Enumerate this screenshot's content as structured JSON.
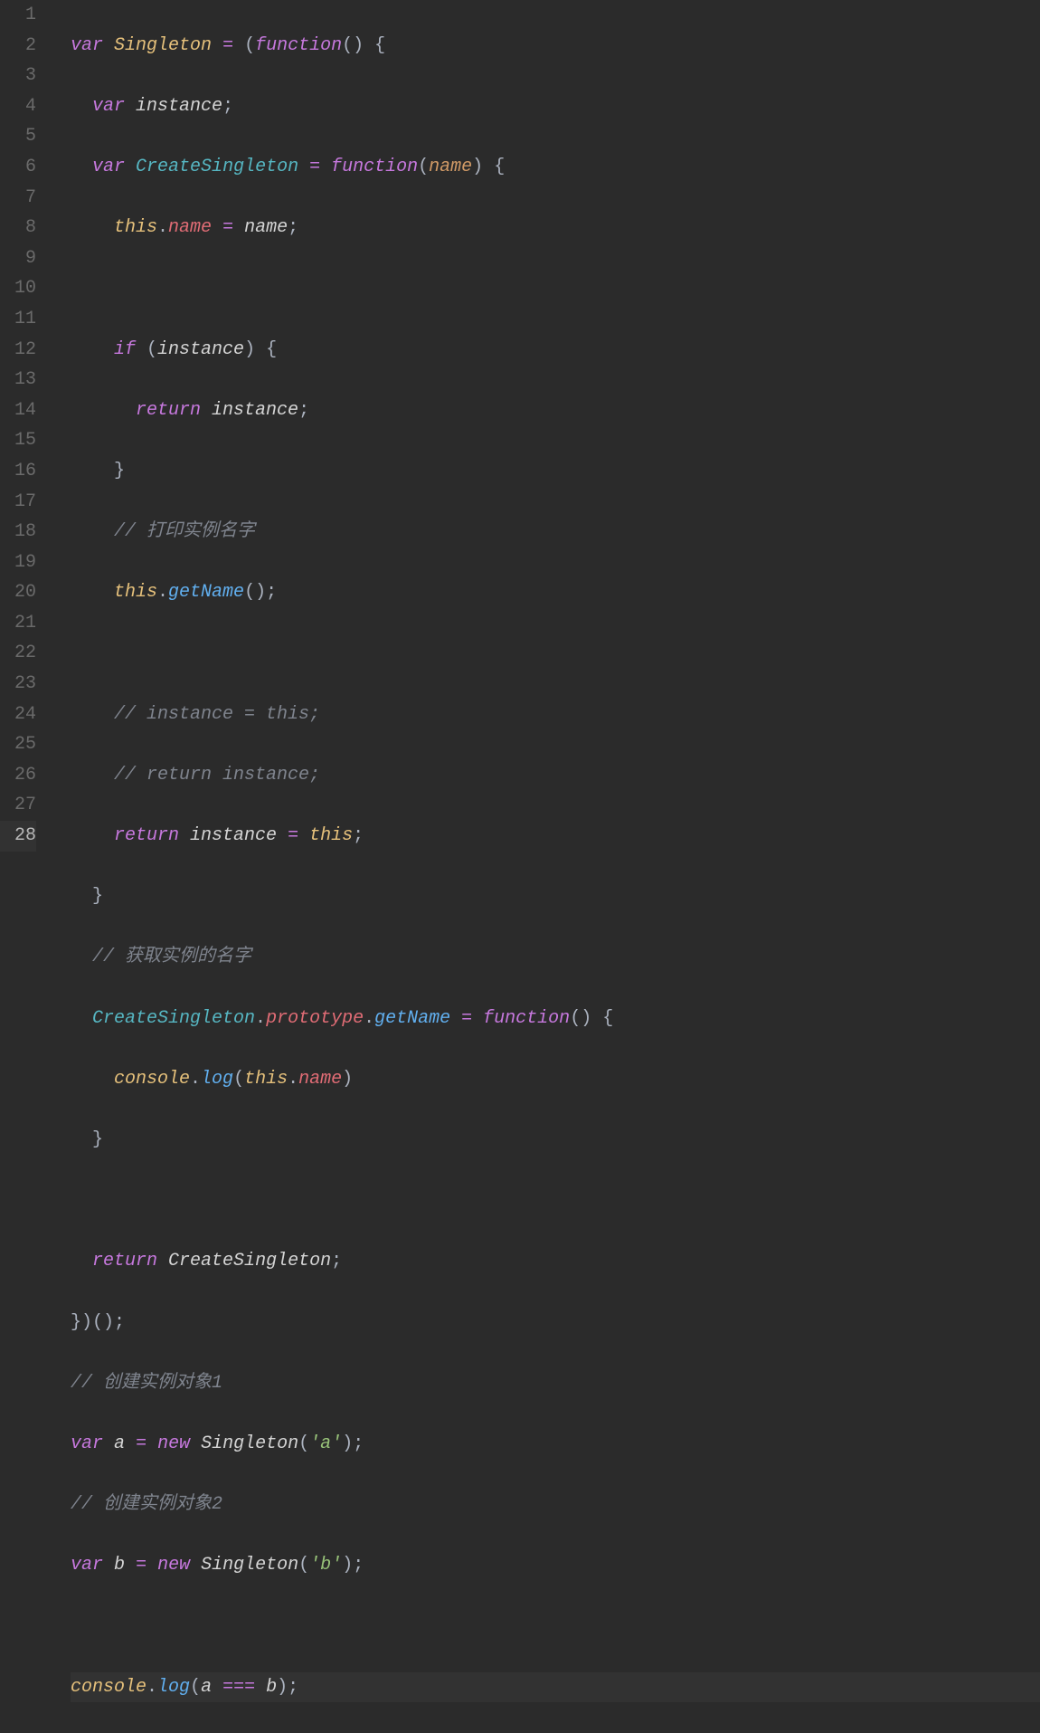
{
  "editor": {
    "activeLine": 28,
    "lineNumbers": [
      "1",
      "2",
      "3",
      "4",
      "5",
      "6",
      "7",
      "8",
      "9",
      "10",
      "11",
      "12",
      "13",
      "14",
      "15",
      "16",
      "17",
      "18",
      "19",
      "20",
      "21",
      "22",
      "23",
      "24",
      "25",
      "26",
      "27",
      "28"
    ],
    "tokens": {
      "l1": {
        "var": "var",
        "Singleton": "Singleton",
        "eq": "=",
        "paren": "(",
        "function": "function",
        "p2": "()",
        "brace": " {"
      },
      "l2": {
        "var": "var",
        "instance": "instance",
        "semi": ";"
      },
      "l3": {
        "var": "var",
        "CreateSingleton": "CreateSingleton",
        "eq": "=",
        "function": "function",
        "p": "(",
        "name": "name",
        "p2": ")",
        "brace": " {"
      },
      "l4": {
        "this": "this",
        "dot": ".",
        "name": "name",
        "eq": "=",
        "name2": "name",
        "semi": ";"
      },
      "l6": {
        "if": "if",
        "p": " (",
        "instance": "instance",
        "p2": ")",
        "brace": " {"
      },
      "l7": {
        "return": "return",
        "instance": "instance",
        "semi": ";"
      },
      "l8": {
        "brace": "}"
      },
      "l9": {
        "cmt": "// 打印实例名字"
      },
      "l10": {
        "this": "this",
        "dot": ".",
        "getName": "getName",
        "p": "()",
        "semi": ";"
      },
      "l12": {
        "cmt": "// instance = this;"
      },
      "l13": {
        "cmt": "// return instance;"
      },
      "l14": {
        "return": "return",
        "instance": "instance",
        "eq": "=",
        "this": "this",
        "semi": ";"
      },
      "l15": {
        "brace": "}"
      },
      "l16": {
        "cmt": "// 获取实例的名字"
      },
      "l17": {
        "CreateSingleton": "CreateSingleton",
        "dot": ".",
        "prototype": "prototype",
        "dot2": ".",
        "getName": "getName",
        "eq": "=",
        "function": "function",
        "p": "()",
        "brace": " {"
      },
      "l18": {
        "console": "console",
        "dot": ".",
        "log": "log",
        "p": "(",
        "this": "this",
        "dot2": ".",
        "name": "name",
        "p2": ")"
      },
      "l19": {
        "brace": "}"
      },
      "l21": {
        "return": "return",
        "CreateSingleton": "CreateSingleton",
        "semi": ";"
      },
      "l22": {
        "brace": "})();"
      },
      "l23": {
        "cmt": "// 创建实例对象1"
      },
      "l24": {
        "var": "var",
        "a": "a",
        "eq": "=",
        "new": "new",
        "Singleton": "Singleton",
        "p": "(",
        "str": "'a'",
        "p2": ")",
        "semi": ";"
      },
      "l25": {
        "cmt": "// 创建实例对象2"
      },
      "l26": {
        "var": "var",
        "b": "b",
        "eq": "=",
        "new": "new",
        "Singleton": "Singleton",
        "p": "(",
        "str": "'b'",
        "p2": ")",
        "semi": ";"
      },
      "l28": {
        "console": "console",
        "dot": ".",
        "log": "log",
        "p": "(",
        "a": "a",
        "op": "===",
        "b": "b",
        "p2": ")",
        "semi": ";"
      }
    }
  }
}
